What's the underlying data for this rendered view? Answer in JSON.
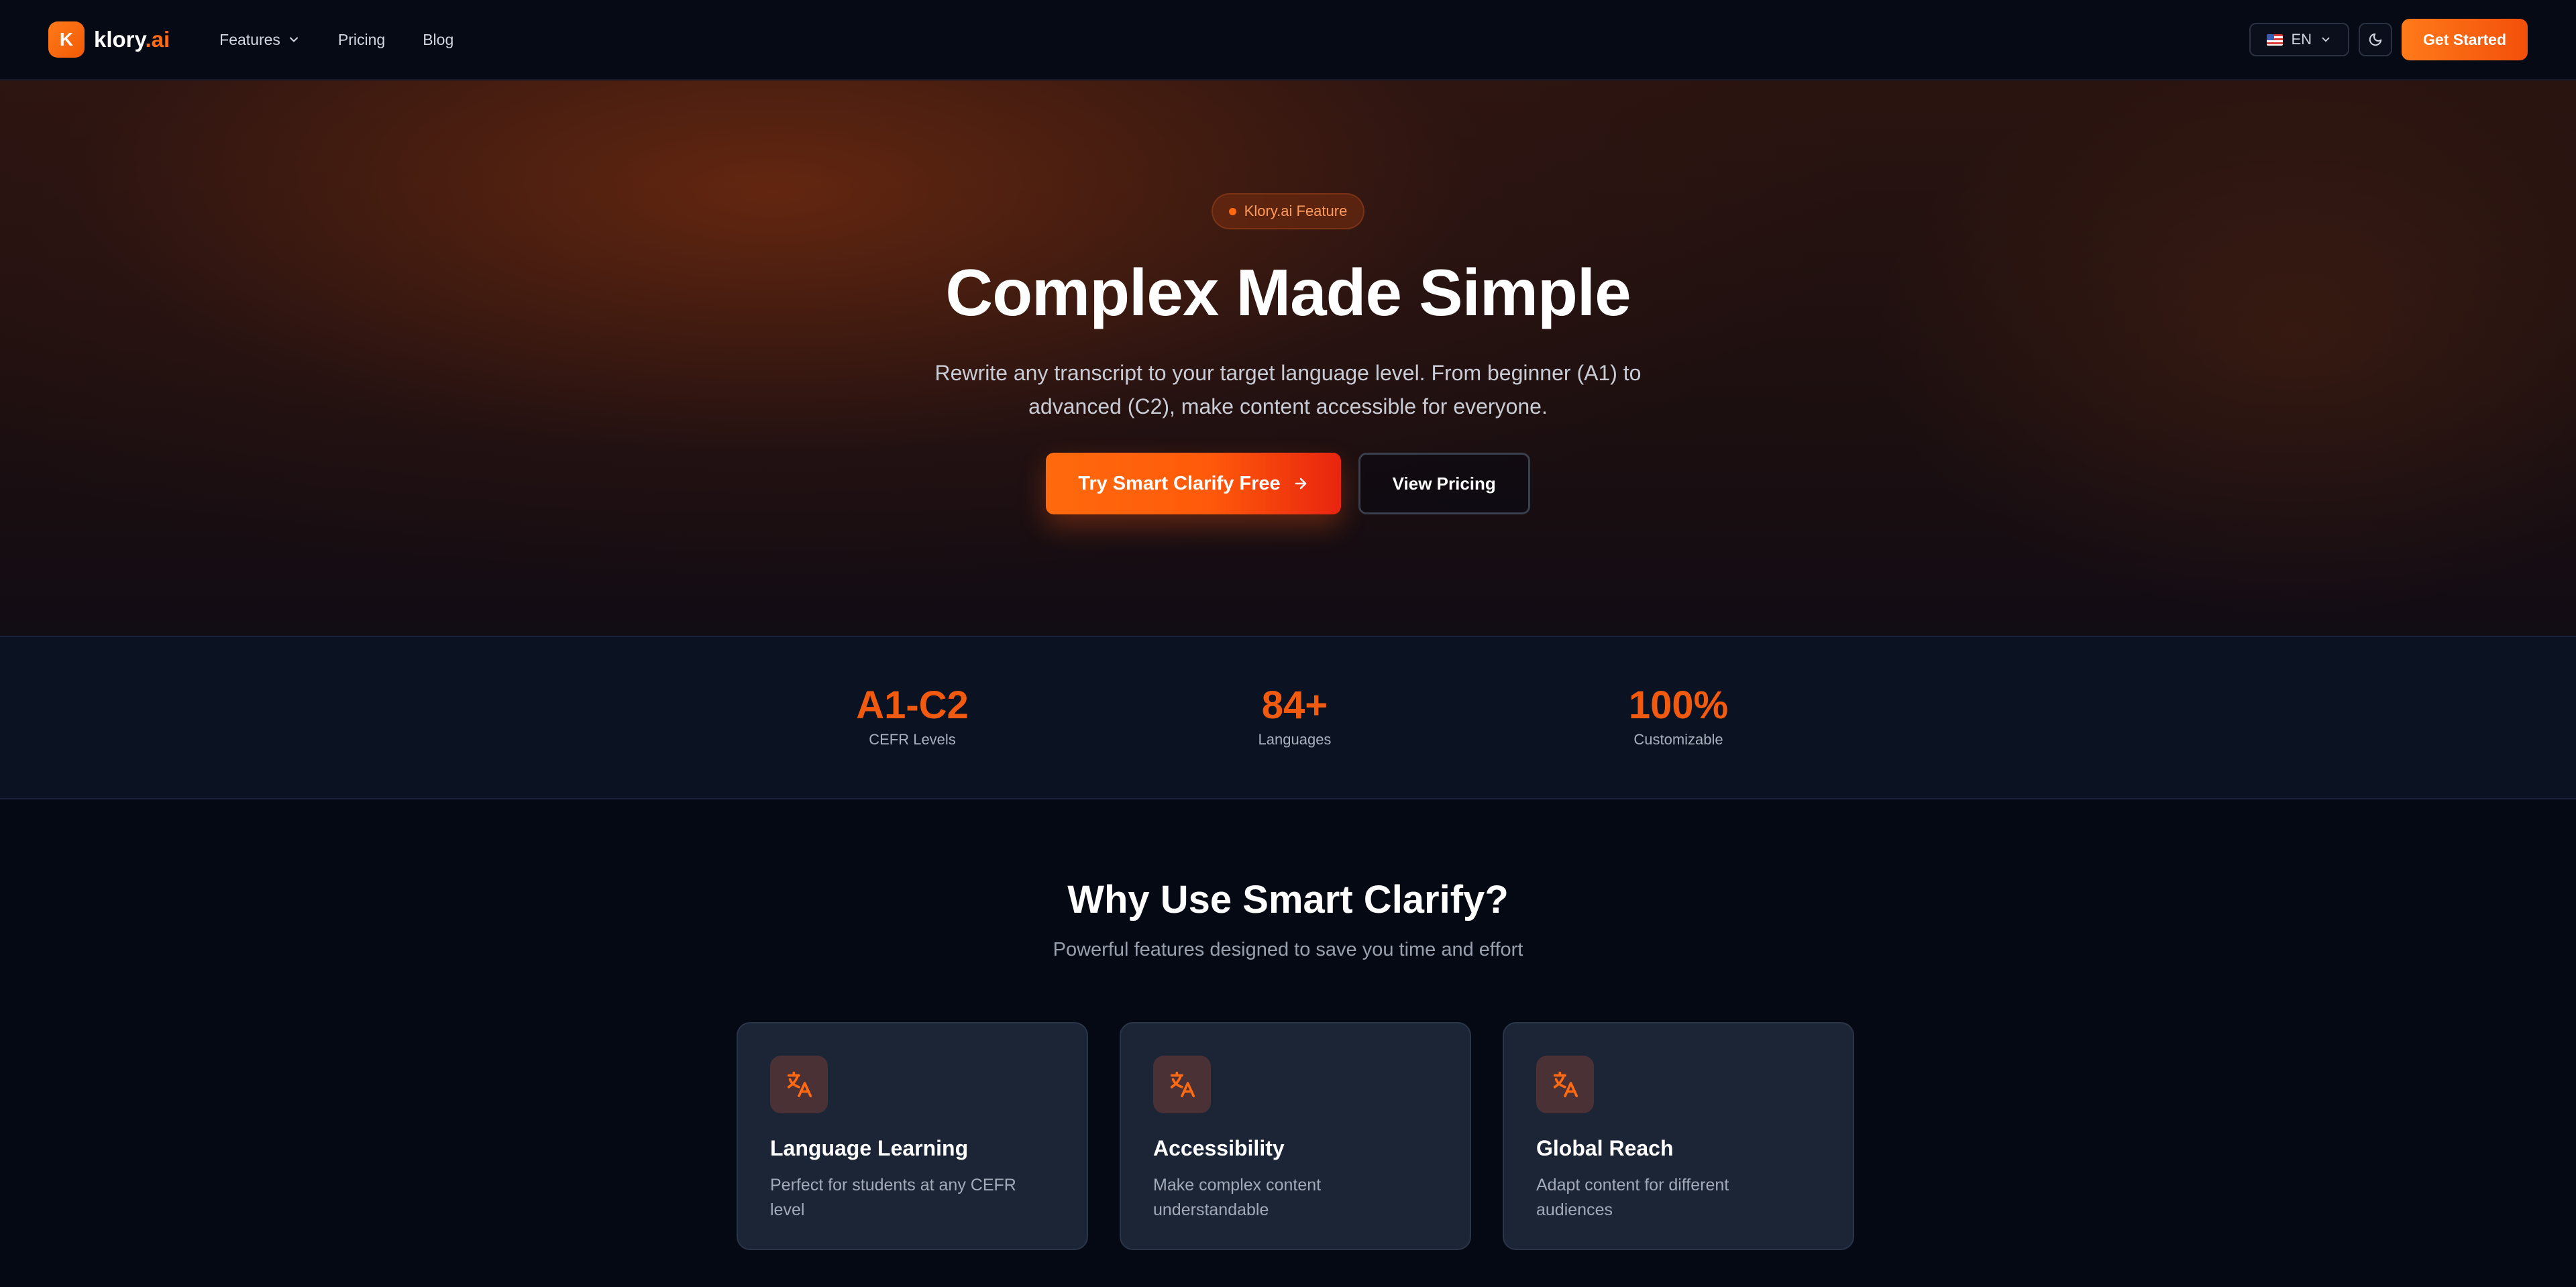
{
  "nav": {
    "logo_letter": "K",
    "brand_name": "klory",
    "brand_suffix": ".ai",
    "links": [
      {
        "label": "Features"
      },
      {
        "label": "Pricing"
      },
      {
        "label": "Blog"
      }
    ],
    "language": "EN",
    "cta": "Get Started"
  },
  "hero": {
    "badge": "Klory.ai Feature",
    "title": "Complex Made Simple",
    "subtitle": "Rewrite any transcript to your target language level. From beginner (A1) to advanced (C2), make content accessible for everyone.",
    "primary_button": "Try Smart Clarify Free",
    "secondary_button": "View Pricing"
  },
  "stats": [
    {
      "value": "A1-C2",
      "label": "CEFR Levels"
    },
    {
      "value": "84+",
      "label": "Languages"
    },
    {
      "value": "100%",
      "label": "Customizable"
    }
  ],
  "features": {
    "title": "Why Use Smart Clarify?",
    "subtitle": "Powerful features designed to save you time and effort",
    "cards": [
      {
        "icon": "translate-icon",
        "title": "Language Learning",
        "description": "Perfect for students at any CEFR level"
      },
      {
        "icon": "translate-icon",
        "title": "Accessibility",
        "description": "Make complex content understandable"
      },
      {
        "icon": "translate-icon",
        "title": "Global Reach",
        "description": "Adapt content for different audiences"
      }
    ]
  },
  "colors": {
    "accent": "#ff6a13",
    "background": "#050914",
    "card": "#1b2536"
  }
}
